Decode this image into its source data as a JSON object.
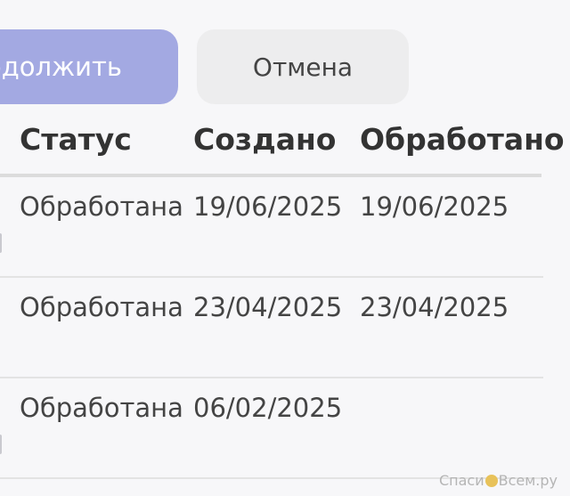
{
  "buttons": {
    "continue_label": "одолжить",
    "cancel_label": "Отмена"
  },
  "table": {
    "columns": [
      "Статус",
      "Создано",
      "Обработано"
    ],
    "rows": [
      {
        "status": "Обработана",
        "created": "19/06/2025",
        "processed": "19/06/2025"
      },
      {
        "status": "Обработана",
        "created": "23/04/2025",
        "processed": "23/04/2025"
      },
      {
        "status": "Обработана",
        "created": "06/02/2025",
        "processed": ""
      }
    ]
  },
  "watermark": {
    "text_left": "Спаси",
    "text_right": "Всем.ру"
  },
  "colors": {
    "continue_bg": "#a3a9e2",
    "cancel_bg": "#ededee",
    "page_bg": "#f7f7f9"
  }
}
